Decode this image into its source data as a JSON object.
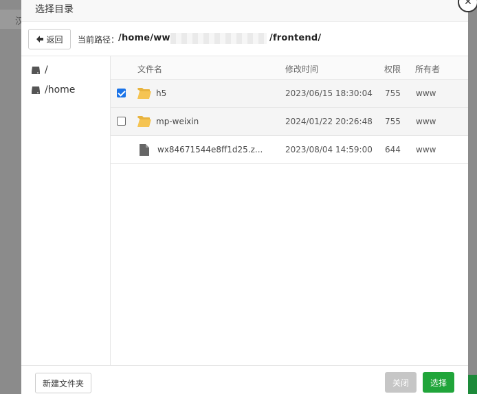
{
  "backdrop": {
    "left_label": "汉"
  },
  "dialog": {
    "title": "选择目录",
    "back_label": "返回",
    "path_label": "当前路径：",
    "path_start": "/home/www",
    "path_end": "/frontend/"
  },
  "tree": {
    "items": [
      {
        "label": "/"
      },
      {
        "label": "/home"
      }
    ]
  },
  "table": {
    "headers": {
      "name": "文件名",
      "mtime": "修改时间",
      "perm": "权限",
      "owner": "所有者"
    },
    "rows": [
      {
        "type": "folder",
        "checked": true,
        "name": "h5",
        "mtime": "2023/06/15 18:30:04",
        "perm": "755",
        "owner": "www"
      },
      {
        "type": "folder",
        "checked": false,
        "name": "mp-weixin",
        "mtime": "2024/01/22 20:26:48",
        "perm": "755",
        "owner": "www"
      },
      {
        "type": "file",
        "checked": false,
        "name": "wx84671544e8ff1d25.z...",
        "mtime": "2023/08/04 14:59:00",
        "perm": "644",
        "owner": "www"
      }
    ]
  },
  "footer": {
    "new_folder_label": "新建文件夹",
    "close_label": "关闭",
    "select_label": "选择"
  },
  "colors": {
    "accent_green": "#20a53a",
    "checkbox_blue": "#1a73e8",
    "folder_yellow": "#f5c453"
  }
}
